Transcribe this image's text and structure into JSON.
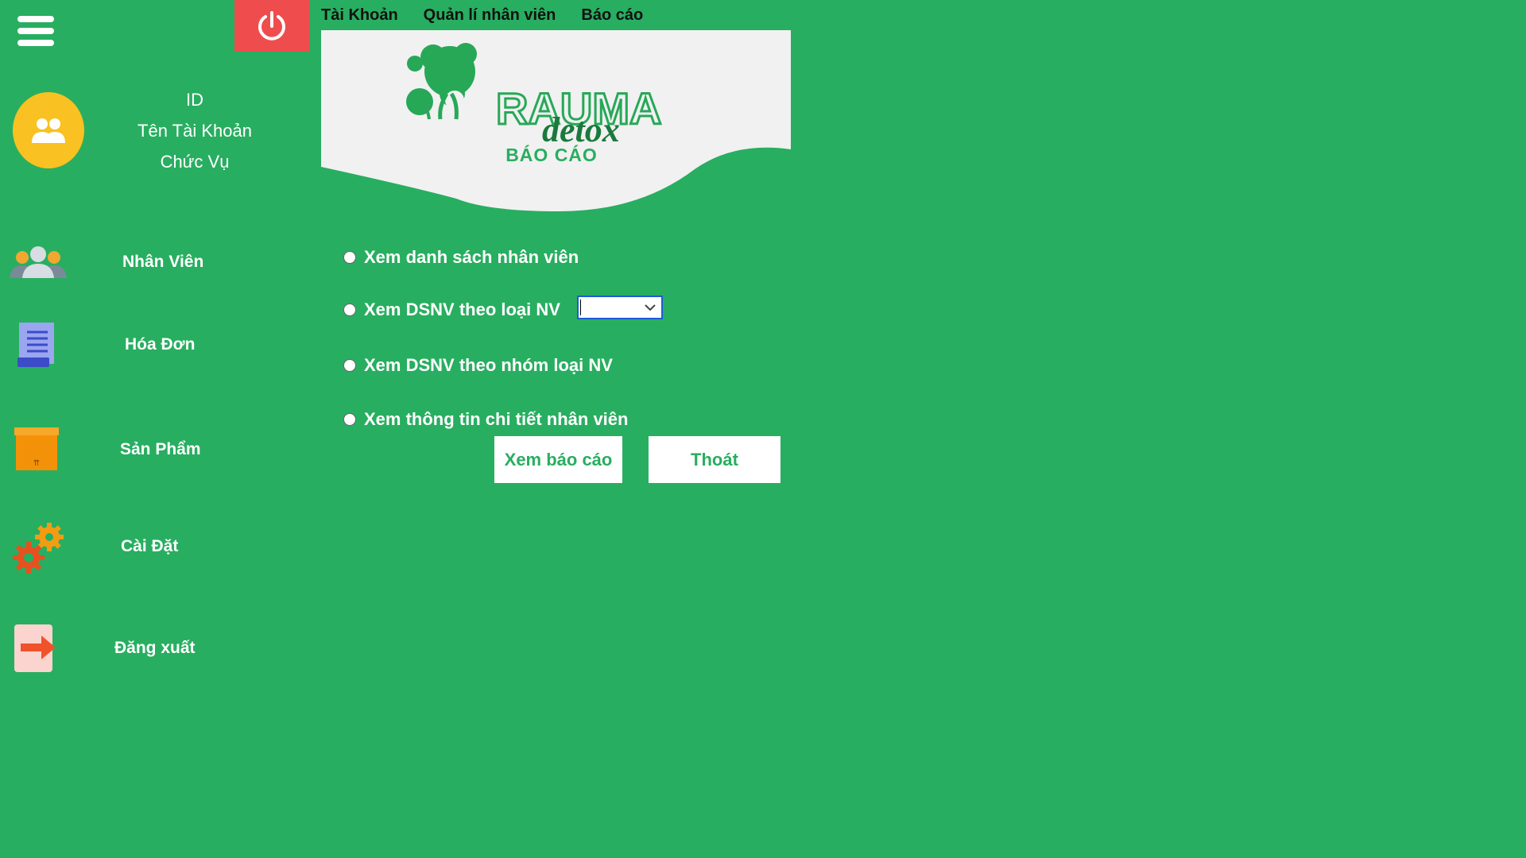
{
  "header": {
    "menu": [
      {
        "label": "Tài Khoản"
      },
      {
        "label": "Quản lí nhân viên"
      },
      {
        "label": "Báo cáo"
      }
    ]
  },
  "account": {
    "id": "ID",
    "name": "Tên Tài Khoản",
    "role": "Chức Vụ"
  },
  "sidebar": {
    "items": [
      {
        "label": "Nhân Viên",
        "icon": "employees-icon"
      },
      {
        "label": "Hóa Đơn",
        "icon": "invoice-icon"
      },
      {
        "label": "Sản Phẩm",
        "icon": "product-box-icon"
      },
      {
        "label": "Cài Đặt",
        "icon": "settings-gears-icon"
      },
      {
        "label": "Đăng xuất",
        "icon": "logout-icon"
      }
    ]
  },
  "banner": {
    "logo_main": "RAUMA",
    "logo_sub": "detox",
    "title": "BÁO CÁO"
  },
  "report": {
    "options": [
      {
        "label": "Xem danh sách nhân viên"
      },
      {
        "label": "Xem DSNV theo loại NV"
      },
      {
        "label": "Xem DSNV theo nhóm loại NV"
      },
      {
        "label": "Xem thông tin chi tiết nhân viên"
      }
    ],
    "view_button": "Xem báo cáo",
    "exit_button": "Thoát"
  },
  "colors": {
    "background": "#28ae60",
    "power": "#ef4d4d",
    "avatar": "#f9c121"
  }
}
